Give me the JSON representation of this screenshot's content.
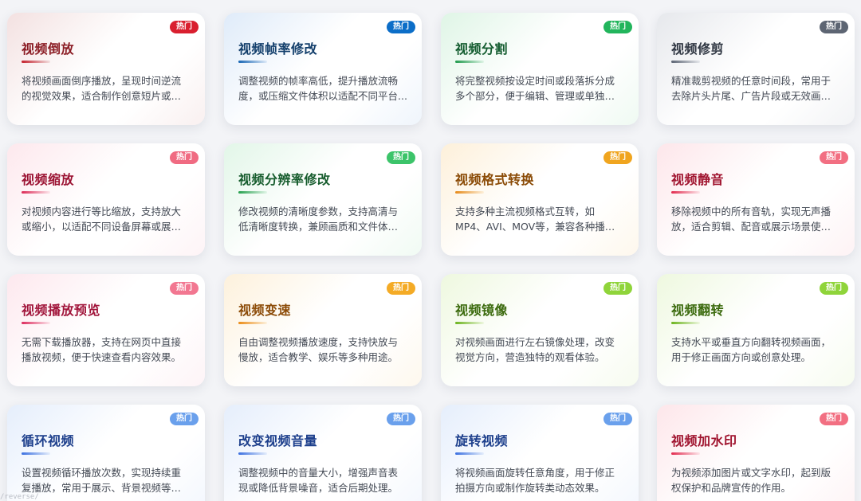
{
  "cards": [
    {
      "title": "视频倒放",
      "badge": "热门",
      "desc": "将视频画面倒序播放，呈现时间逆流的视觉效果，适合制作创意短片或特效...",
      "title_color": "#8b1c24",
      "accent": "#c4202c",
      "badge_color": "#d91f2f",
      "tint": "#f3e1e1"
    },
    {
      "title": "视频帧率修改",
      "badge": "热门",
      "desc": "调整视频的帧率高低，提升播放流畅度，或压缩文件体积以适配不同平台...",
      "title_color": "#123e6b",
      "accent": "#1866b4",
      "badge_color": "#0c6ec8",
      "tint": "#dfebf9"
    },
    {
      "title": "视频分割",
      "badge": "热门",
      "desc": "将完整视频按设定时间或段落拆分成多个部分，便于编辑、管理或单独使用。",
      "title_color": "#135c2f",
      "accent": "#1f9a4c",
      "badge_color": "#22b55c",
      "tint": "#dff5e6"
    },
    {
      "title": "视频修剪",
      "badge": "热门",
      "desc": "精准裁剪视频的任意时间段，常用于去除片头片尾、广告片段或无效画面。",
      "title_color": "#2f3642",
      "accent": "#5b6473",
      "badge_color": "#5d6573",
      "tint": "#e6e8ec"
    },
    {
      "title": "视频缩放",
      "badge": "热门",
      "desc": "对视频内容进行等比缩放，支持放大或缩小，以适配不同设备屏幕或展示需...",
      "title_color": "#9b1232",
      "accent": "#dc2a55",
      "badge_color": "#f06b82",
      "tint": "#fde8ed"
    },
    {
      "title": "视频分辨率修改",
      "badge": "热门",
      "desc": "修改视频的清晰度参数，支持高清与低清晰度转换，兼顾画质和文件体积。",
      "title_color": "#165c2d",
      "accent": "#25a04d",
      "badge_color": "#3cc46a",
      "tint": "#e2f6e8"
    },
    {
      "title": "视频格式转换",
      "badge": "热门",
      "desc": "支持多种主流视频格式互转，如MP4、AVI、MOV等，兼容各种播放设备和平...",
      "title_color": "#8a4a05",
      "accent": "#e68a1a",
      "badge_color": "#f0a51f",
      "tint": "#fdf0da"
    },
    {
      "title": "视频静音",
      "badge": "热门",
      "desc": "移除视频中的所有音轨，实现无声播放，适合剪辑、配音或展示场景使用。",
      "title_color": "#a0142f",
      "accent": "#e22a4e",
      "badge_color": "#f26f82",
      "tint": "#fde6ea"
    },
    {
      "title": "视频播放预览",
      "badge": "热门",
      "desc": "无需下载播放器，支持在网页中直接播放视频，便于快速查看内容效果。",
      "title_color": "#a1153b",
      "accent": "#dc2a5c",
      "badge_color": "#f27791",
      "tint": "#fde8ee"
    },
    {
      "title": "视频变速",
      "badge": "热门",
      "desc": "自由调整视频播放速度，支持快放与慢放，适合教学、娱乐等多种用途。",
      "title_color": "#8c4b07",
      "accent": "#eb8c17",
      "badge_color": "#f4ab26",
      "tint": "#fdf1dc"
    },
    {
      "title": "视频镜像",
      "badge": "热门",
      "desc": "对视频画面进行左右镜像处理，改变视觉方向，营造独特的观看体验。",
      "title_color": "#3b6a0d",
      "accent": "#6bb31d",
      "badge_color": "#8fd43a",
      "tint": "#eef8df"
    },
    {
      "title": "视频翻转",
      "badge": "热门",
      "desc": "支持水平或垂直方向翻转视频画面，用于修正画面方向或创意处理。",
      "title_color": "#3b6a0d",
      "accent": "#6bb31d",
      "badge_color": "#8fd43a",
      "tint": "#eef8df"
    },
    {
      "title": "循环视频",
      "badge": "热门",
      "desc": "设置视频循环播放次数，实现持续重复播放，常用于展示、背景视频等场景。",
      "title_color": "#1d3f8c",
      "accent": "#3a6fe0",
      "badge_color": "#6aa0ec",
      "tint": "#e5eefc"
    },
    {
      "title": "改变视频音量",
      "badge": "热门",
      "desc": "调整视频中的音量大小，增强声音表现或降低背景噪音，适合后期处理。",
      "title_color": "#1d3f8c",
      "accent": "#3a6fe0",
      "badge_color": "#6aa0ec",
      "tint": "#e5eefc"
    },
    {
      "title": "旋转视频",
      "badge": "热门",
      "desc": "将视频画面旋转任意角度，用于修正拍摄方向或制作旋转类动态效果。",
      "title_color": "#1d3f8c",
      "accent": "#3a6fe0",
      "badge_color": "#6aa0ec",
      "tint": "#e5eefc"
    },
    {
      "title": "视频加水印",
      "badge": "热门",
      "desc": "为视频添加图片或文字水印，起到版权保护和品牌宣传的作用。",
      "title_color": "#a0142f",
      "accent": "#e22a4e",
      "badge_color": "#f26f82",
      "tint": "#fde6ea"
    }
  ],
  "footer_note": "/reverse/"
}
